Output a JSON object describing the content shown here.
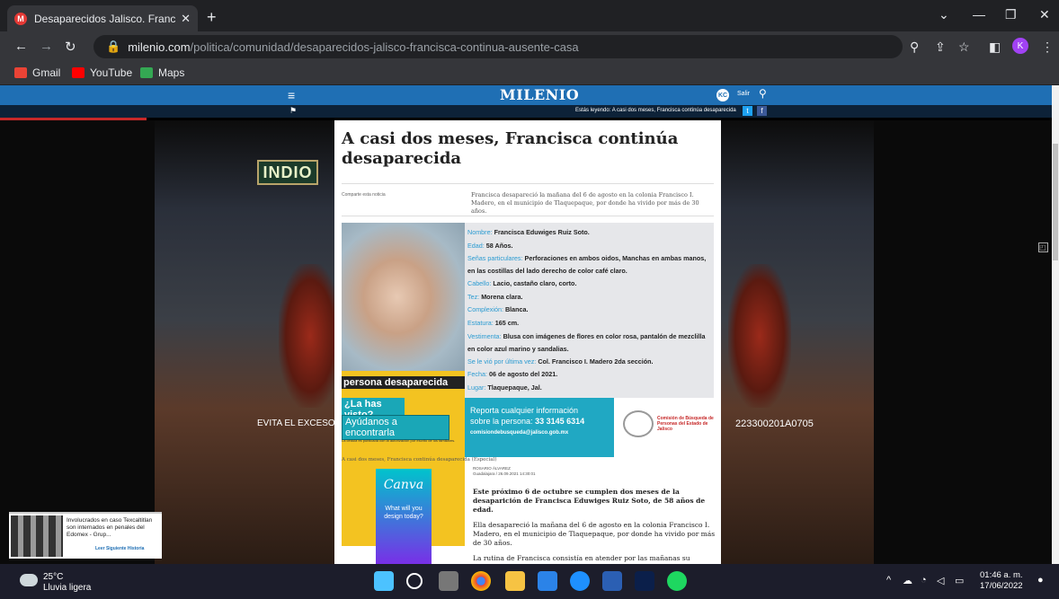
{
  "browser": {
    "tab_title": "Desaparecidos Jalisco. Francisca",
    "tab_favicon": "M",
    "new_tab": "+",
    "url_domain": "milenio.com",
    "url_path": "/politica/comunidad/desaparecidos-jalisco-francisca-continua-ausente-casa",
    "profile_initial": "K",
    "bookmarks": [
      "Gmail",
      "YouTube",
      "Maps"
    ]
  },
  "site": {
    "logo": "MILENIO",
    "user_initials": "KC",
    "salir": "Salir",
    "reading_label": "Estás leyendo: A casi dos meses, Francisca continúa desaparecida"
  },
  "ads": {
    "brand": "INDIO",
    "left_text": "EVITA EL EXCESO",
    "right_text": "223300201A0705"
  },
  "article": {
    "title": "A casi dos meses, Francisca continúa desaparecida",
    "comparte": "Comparte esta noticia",
    "summary": "Francisca desapareció la mañana del 6 de agosto en la colonia Francisco I. Madero, en el municipio de Tlaquepaque, por donde ha vivido por más de 30 años.",
    "caption": "A casi dos meses, Francisca continúa desaparecida (Especial)",
    "author": "ROSARIO ÁLVAREZ",
    "dateline": "Guadalajara / 26.09.2021 14:30:01",
    "paragraphs": [
      "Este próximo 6 de octubre se cumplen dos meses de la desaparición de Francisca Eduwiges Ruiz Soto, de 58 años de edad.",
      "Ella desapareció la mañana del 6 de agosto en la colonia Francisco I. Madero, en el municipio de Tlaquepaque, por donde ha vivido por más de 30 años.",
      "La rutina de Francisca consistía en atender por las mañanas su negocio de venta de productos de limpieza, en su propia casa y por las tardes salía de"
    ]
  },
  "poster": {
    "fields": [
      {
        "k": "Nombre:",
        "v": "Francisca Eduwiges Ruiz Soto."
      },
      {
        "k": "Edad:",
        "v": "58 Años."
      },
      {
        "k": "Señas particulares:",
        "v": "Perforaciones en ambos oidos, Manchas en ambas manos, en las costillas del lado derecho de color café claro."
      },
      {
        "k": "Cabello:",
        "v": "Lacio, castaño claro, corto."
      },
      {
        "k": "Tez:",
        "v": "Morena clara."
      },
      {
        "k": "Complexión:",
        "v": "Blanca."
      },
      {
        "k": "Estatura:",
        "v": "165 cm."
      },
      {
        "k": "Vestimenta:",
        "v": "Blusa con imágenes de flores en color rosa, pantalón de mezclilla en color azul marino y sandalias."
      },
      {
        "k": "Se le vió por última vez:",
        "v": "Col. Francisco I. Madero 2da sección."
      },
      {
        "k": "Fecha:",
        "v": "06 de agosto del 2021."
      },
      {
        "k": "Lugar:",
        "v": "Tlaquepaque, Jal."
      }
    ],
    "desaparecida": "persona desaparecida",
    "la_has_visto": "¿La has visto?",
    "ayudanos": "Ayúdanos a encontrarla",
    "note": "La cédula es publicada con la autorización por escrito de los familiares.",
    "report_l1": "Reporta cualquier información",
    "report_l2": "sobre la persona:",
    "report_phone": "33 3145 6314",
    "report_email": "comisiondebusqueda@jalisco.gob.mx",
    "comision": "Comisión de Búsqueda de Personas del Estado de Jalisco"
  },
  "canva": {
    "logo": "Canva",
    "q": "What will you design today?"
  },
  "notification": {
    "text": "Involucrados en caso Texcaltitlan son internados en penales del Edomex - Grup...",
    "more": "Leer Siguiente Historia"
  },
  "taskbar": {
    "temp": "25°C",
    "weather": "Lluvia ligera",
    "time": "01:46 a. m.",
    "date": "17/06/2022"
  }
}
